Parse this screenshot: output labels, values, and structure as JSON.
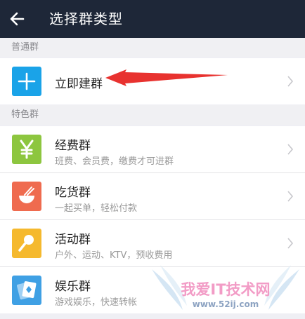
{
  "header": {
    "title": "选择群类型"
  },
  "sections": {
    "normal": "普通群",
    "special": "特色群"
  },
  "create": {
    "title": "立即建群"
  },
  "groups": [
    {
      "title": "经费群",
      "subtitle": "班费、会员费，缴费才可进群",
      "color": "#8dc63f",
      "icon": "yen-icon"
    },
    {
      "title": "吃货群",
      "subtitle": "一起买单，轻松付款",
      "color": "#ef6b4f",
      "icon": "food-bowl-icon"
    },
    {
      "title": "活动群",
      "subtitle": "户外、运动、KTV，预收费用",
      "color": "#f5b92e",
      "icon": "microphone-icon"
    },
    {
      "title": "娱乐群",
      "subtitle": "游戏娱乐，快速转帐",
      "color": "#3fa0e4",
      "icon": "playing-cards-icon"
    }
  ],
  "colors": {
    "header_bg": "#1e2738",
    "create_icon_bg": "#1aa3e8",
    "arrow": "#e8322f"
  },
  "watermark": {
    "text": "我爱IT技术网",
    "url": "www.52ij.com"
  }
}
